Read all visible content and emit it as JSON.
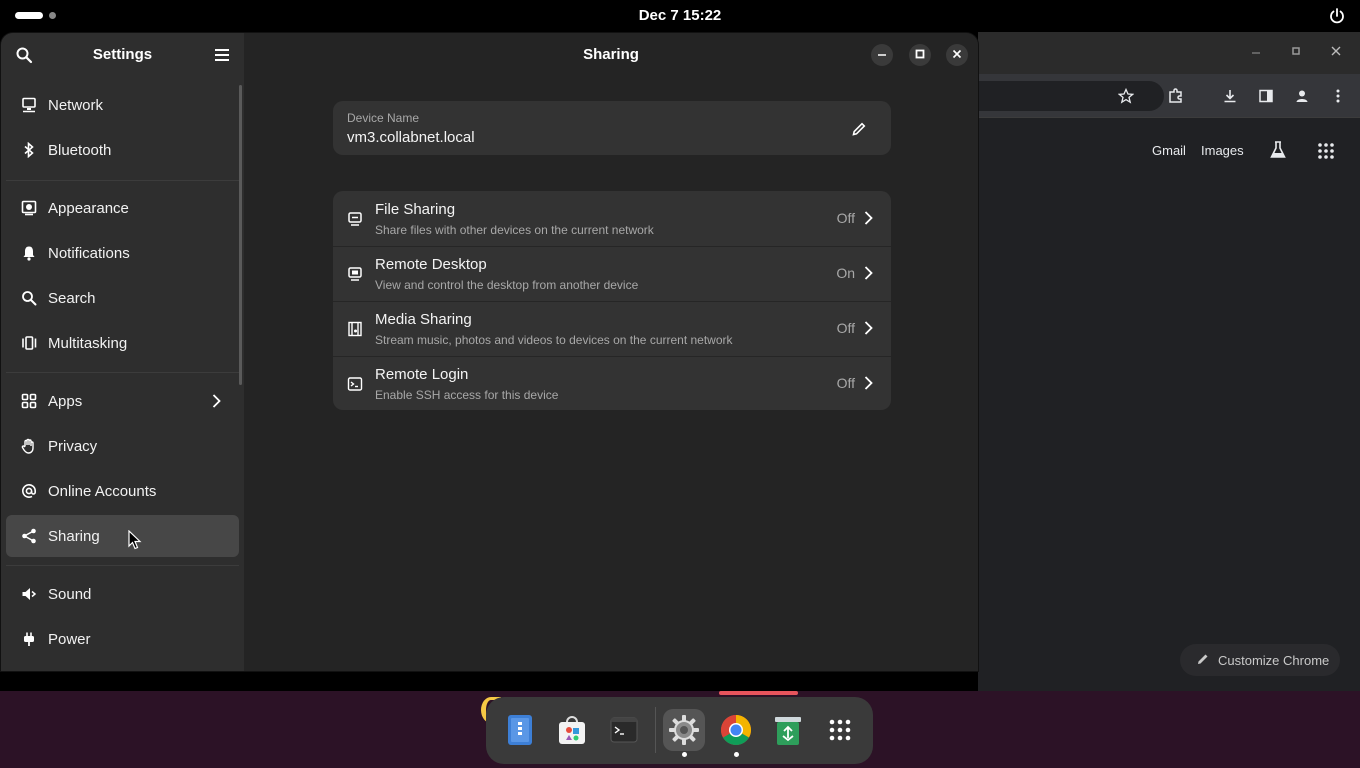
{
  "topbar": {
    "clock": "Dec 7  15:22"
  },
  "settings": {
    "sidebar_title": "Settings",
    "page_title": "Sharing",
    "sidebar_items": [
      {
        "label": "Network"
      },
      {
        "label": "Bluetooth"
      },
      {
        "label": "Appearance"
      },
      {
        "label": "Notifications"
      },
      {
        "label": "Search"
      },
      {
        "label": "Multitasking"
      },
      {
        "label": "Apps"
      },
      {
        "label": "Privacy"
      },
      {
        "label": "Online Accounts"
      },
      {
        "label": "Sharing",
        "selected": true
      },
      {
        "label": "Sound"
      },
      {
        "label": "Power"
      }
    ],
    "device": {
      "label": "Device Name",
      "value": "vm3.collabnet.local"
    },
    "rows": [
      {
        "title": "File Sharing",
        "subtitle": "Share files with other devices on the current network",
        "state": "Off"
      },
      {
        "title": "Remote Desktop",
        "subtitle": "View and control the desktop from another device",
        "state": "On"
      },
      {
        "title": "Media Sharing",
        "subtitle": "Stream music, photos and videos to devices on the current network",
        "state": "Off"
      },
      {
        "title": "Remote Login",
        "subtitle": "Enable SSH access for this device",
        "state": "Off"
      }
    ]
  },
  "chrome": {
    "links": {
      "gmail": "Gmail",
      "images": "Images"
    },
    "customize": "Customize Chrome"
  },
  "dock": {
    "items": [
      "files-icon",
      "software-icon",
      "terminal-icon",
      "settings-icon",
      "chrome-icon",
      "trash-icon",
      "app-grid-icon"
    ]
  },
  "colors": {
    "accent_selected": "#474747",
    "desktop": "#2c1226",
    "window": "#242424",
    "card": "#333333"
  }
}
